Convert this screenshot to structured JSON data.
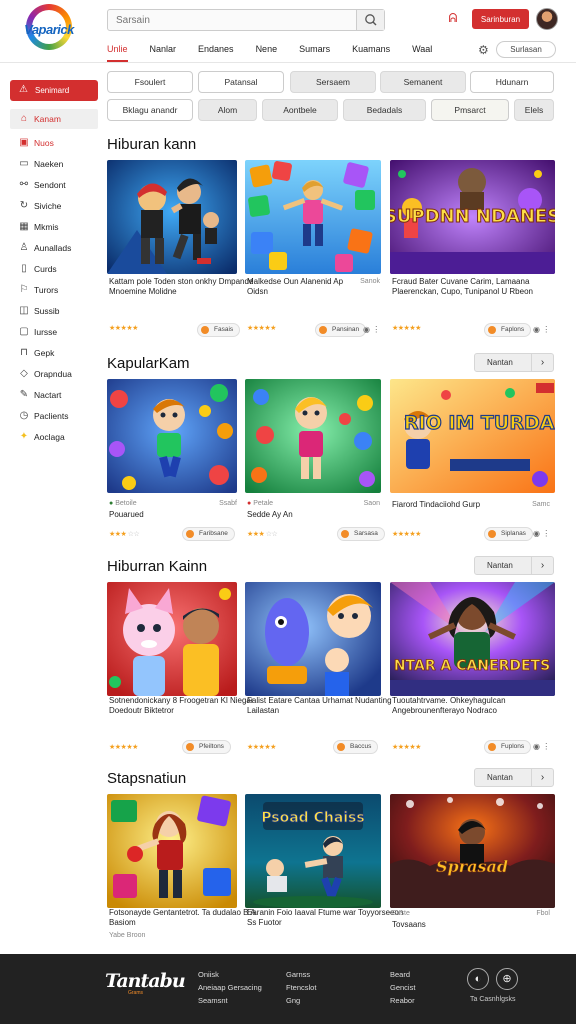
{
  "header": {
    "logo": "Vaparick",
    "search_placeholder": "Sarsain",
    "signup_label": "Sarinburan",
    "nav": [
      "Unlie",
      "Nanlar",
      "Endanes",
      "Nene",
      "Sumars",
      "Kuamans",
      "Waal"
    ],
    "nav_pill": "Surlasan",
    "accent": "#d32f2f"
  },
  "sidebar": {
    "primary": "Senimard",
    "items": [
      "Kanam",
      "Nuos",
      "Naeken",
      "Sendont",
      "Siviche",
      "Mkmis",
      "Aunallads",
      "Curds",
      "Turors",
      "Sussib",
      "Iursse",
      "Gepk",
      "Orapndua",
      "Nactart",
      "Paclients",
      "Aoclaga"
    ]
  },
  "chips_row1": [
    "Fsoulert",
    "Patansal",
    "Sersaem",
    "Semanent",
    "Hdunarn"
  ],
  "chips_row2": [
    "Bklagu anandr",
    "Alom",
    "Aontbele",
    "Bedadals",
    "Pmsarct",
    "Elels"
  ],
  "sections": [
    {
      "title": "Hiburan kann",
      "see_all": "",
      "cards": [
        {
          "title": "Kattam pole Toden ston onkhy Dmpande Mnoemine Molidne",
          "meta": "",
          "meta_r": "",
          "btn": "Fasais"
        },
        {
          "title": "Malkedse Oun Alanenid Ap Oidsn",
          "meta": "",
          "meta_r": "Sanok",
          "btn": "Pansinan"
        },
        {
          "title": "Fcraud Bater Cuvane Carim, Lamaana Plaerenckan, Cupo, Tunipanol U Rbeon",
          "meta": "",
          "meta_r": "",
          "btn": "Faplons"
        }
      ]
    },
    {
      "title": "KapularKam",
      "see_all": "Nantan",
      "cards": [
        {
          "title": "Pouarued",
          "meta": "Betoile",
          "meta_r": "Ssabf",
          "btn": "Faribsane"
        },
        {
          "title": "Sedde Ay An",
          "meta": "Petale",
          "meta_r": "Saon",
          "btn": "Sarsasa"
        },
        {
          "title": "Fiarord Tindaciiohd Gurp",
          "meta": "",
          "meta_r": "Samc",
          "btn": "Siplanas"
        }
      ]
    },
    {
      "title": "Hiburran Kainn",
      "see_all": "Nantan",
      "cards": [
        {
          "title": "Sotnendonickany 8 Froogetran Kl Niegar Doedoutr Biktetror",
          "meta": "",
          "meta_r": "",
          "btn": "Pfeiltons"
        },
        {
          "title": "Falist Eatare Cantaa Urhamat Nudanting Lailastan",
          "meta": "",
          "meta_r": "",
          "btn": "Baccus"
        },
        {
          "title": "Tuoutahtrvame. Ohkeyhagulcan Angebrounenfterayo Nodraco",
          "meta": "",
          "meta_r": "",
          "btn": "Fuplons"
        }
      ]
    },
    {
      "title": "Stapsnatiun",
      "see_all": "Nantan",
      "cards": [
        {
          "title": "Fotsonayde Gentantetrot. Ta dudalao B A Basiom",
          "meta": "Yabe Broon",
          "meta_r": "",
          "btn": ""
        },
        {
          "title": "Earanin Foio Iaaval Ftume war Toyyorseeon Ss Fuotor",
          "meta": "",
          "meta_r": "",
          "btn": ""
        },
        {
          "title": "Tovsaans",
          "meta": "Suste",
          "meta_r": "Fbol",
          "btn": ""
        }
      ]
    }
  ],
  "thumb_text": {
    "s1c3": "SUPDNN NDANES",
    "s2c3": "RIO IM TURDAS",
    "s3c3": "NTAR A CANERDETS",
    "s4c2": "Psoad Chaiss",
    "s4c3": "Sprasad"
  },
  "footer": {
    "logo": "Tantabu",
    "logo_sub": "Grams",
    "col1": [
      "Oniisk",
      "Aneiaap Gersacing",
      "Seamsnt"
    ],
    "col2": [
      "Garnss",
      "Ftencslot",
      "Gng"
    ],
    "col3": [
      "Beard",
      "Gencist",
      "Reabor"
    ],
    "copyright": "Ta Casnhlgsks"
  }
}
